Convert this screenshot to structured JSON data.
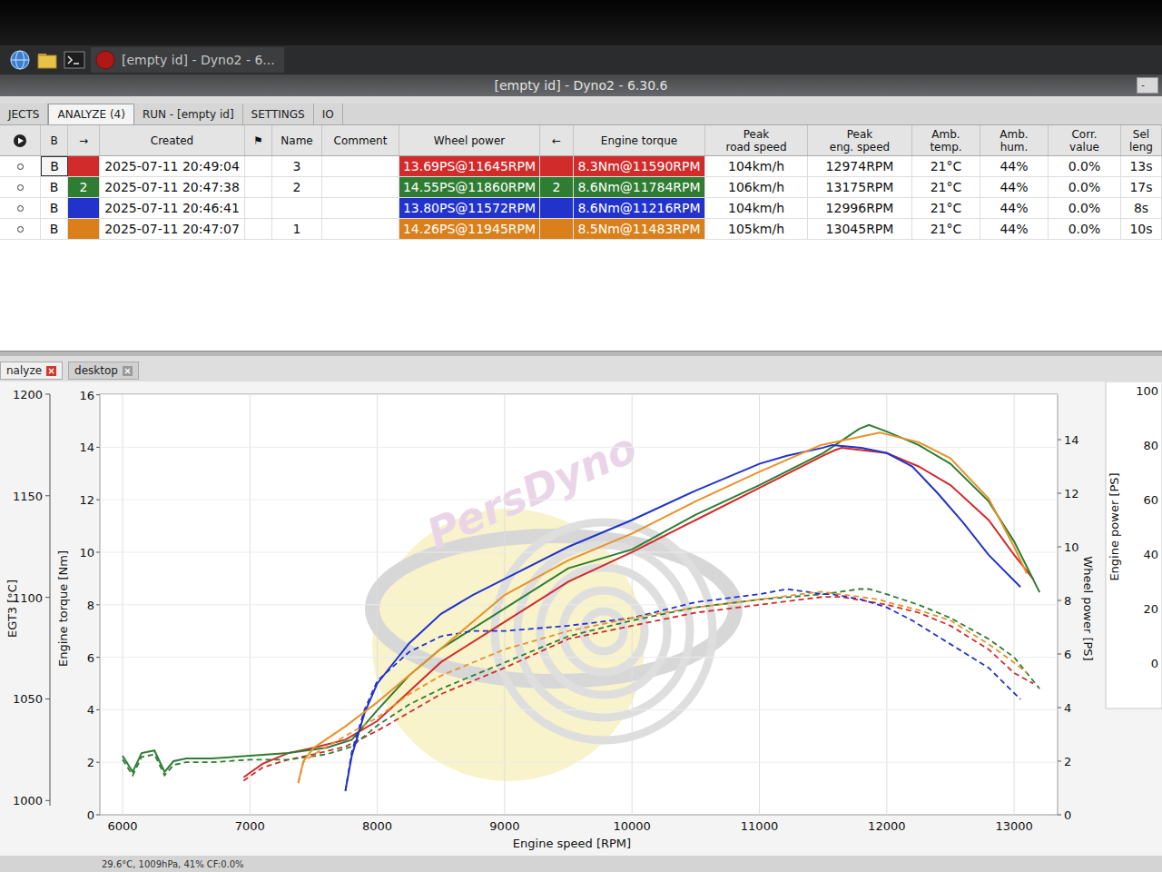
{
  "taskbar": {
    "task": "[empty id] - Dyno2 - 6..."
  },
  "window": {
    "title": "[empty id] - Dyno2 - 6.30.6",
    "button": "-"
  },
  "tabs": [
    {
      "label": "JECTS",
      "selected": false
    },
    {
      "label": "ANALYZE (4)",
      "selected": true
    },
    {
      "label": "RUN - [empty id]",
      "selected": false
    },
    {
      "label": "SETTINGS",
      "selected": false
    },
    {
      "label": "IO",
      "selected": false
    }
  ],
  "table": {
    "columns": [
      [
        "B"
      ],
      [
        "→"
      ],
      [
        "Created"
      ],
      [
        "⚑"
      ],
      [
        "Name"
      ],
      [
        "Comment"
      ],
      [
        "Wheel power"
      ],
      [
        "←"
      ],
      [
        "Engine torque"
      ],
      [
        "Peak",
        "road speed"
      ],
      [
        "Peak",
        "eng. speed"
      ],
      [
        "Amb.",
        "temp."
      ],
      [
        "Amb.",
        "hum."
      ],
      [
        "Corr.",
        "value"
      ],
      [
        "Sel",
        "leng"
      ]
    ],
    "rows": [
      {
        "selected": true,
        "color": "#d22b2b",
        "cells": [
          "B",
          "",
          "2025-07-11 20:49:04",
          "",
          "3",
          "",
          "13.69PS@11645RPM",
          "",
          "8.3Nm@11590RPM",
          "104km/h",
          "12974RPM",
          "21°C",
          "44%",
          "0.0%",
          "13s"
        ]
      },
      {
        "selected": false,
        "color": "#2e7d32",
        "cells": [
          "B",
          "2",
          "2025-07-11 20:47:38",
          "",
          "2",
          "",
          "14.55PS@11860RPM",
          "2",
          "8.6Nm@11784RPM",
          "106km/h",
          "13175RPM",
          "21°C",
          "44%",
          "0.0%",
          "17s"
        ]
      },
      {
        "selected": false,
        "color": "#2233cc",
        "cells": [
          "B",
          "",
          "2025-07-11 20:46:41",
          "",
          "",
          "",
          "13.80PS@11572RPM",
          "",
          "8.6Nm@11216RPM",
          "104km/h",
          "12996RPM",
          "21°C",
          "44%",
          "0.0%",
          "8s"
        ]
      },
      {
        "selected": false,
        "color": "#d9801a",
        "cells": [
          "B",
          "",
          "2025-07-11 20:47:07",
          "",
          "1",
          "",
          "14.26PS@11945RPM",
          "",
          "8.5Nm@11483RPM",
          "105km/h",
          "13045RPM",
          "21°C",
          "44%",
          "0.0%",
          "10s"
        ]
      }
    ]
  },
  "panel_tabs": [
    {
      "label": "nalyze",
      "selected": true
    },
    {
      "label": "desktop",
      "selected": false
    }
  ],
  "chart": {
    "watermark": "PersDyno",
    "x_axis": {
      "label": "Engine speed [RPM]",
      "ticks": [
        "6000",
        "7000",
        "8000",
        "9000",
        "10000",
        "11000",
        "12000",
        "13000"
      ]
    },
    "egt_axis": {
      "label": "EGT3 [°C]",
      "ticks": [
        "1000",
        "1050",
        "1100",
        "1150",
        "1200"
      ]
    },
    "torque_axis": {
      "label": "Engine torque [Nm]",
      "ticks": [
        "0",
        "2",
        "4",
        "6",
        "8",
        "10",
        "12",
        "14",
        "16"
      ]
    },
    "power_axis": {
      "label": "Wheel power [PS]",
      "ticks": [
        "0",
        "2",
        "4",
        "6",
        "8",
        "10",
        "12",
        "14"
      ]
    },
    "engine_power_axis": {
      "label": "Engine power [PS]",
      "ticks": [
        "0",
        "20",
        "40",
        "60",
        "80",
        "100"
      ]
    },
    "series": [
      {
        "color": "#d22b2b",
        "rpm": [
          6950,
          7100,
          7300,
          7500,
          7750,
          8000,
          8250,
          8500,
          9000,
          9500,
          10000,
          10500,
          11000,
          11500,
          11590,
          11645,
          12000,
          12250,
          12500,
          12800,
          13000,
          13150
        ],
        "power": [
          1.4,
          1.9,
          2.3,
          2.5,
          2.8,
          3.5,
          4.6,
          5.7,
          7.2,
          8.7,
          9.8,
          11.0,
          12.2,
          13.4,
          13.6,
          13.69,
          13.5,
          13.0,
          12.3,
          11.0,
          9.7,
          8.8
        ],
        "torque": [
          1.3,
          1.8,
          2.1,
          2.3,
          2.6,
          3.2,
          3.9,
          4.6,
          5.6,
          6.7,
          7.2,
          7.7,
          8.0,
          8.3,
          8.3,
          8.3,
          8.0,
          7.7,
          7.2,
          6.3,
          5.4,
          5.0
        ]
      },
      {
        "color": "#2e7d32",
        "rpm": [
          6000,
          6080,
          6150,
          6250,
          6330,
          6400,
          6500,
          6700,
          7000,
          7300,
          7600,
          7800,
          8000,
          8250,
          8500,
          9000,
          9500,
          10000,
          10500,
          11000,
          11500,
          11784,
          11860,
          12000,
          12250,
          12500,
          12800,
          13000,
          13200
        ],
        "power": [
          2.2,
          1.6,
          2.3,
          2.4,
          1.6,
          2.0,
          2.1,
          2.1,
          2.2,
          2.3,
          2.5,
          2.8,
          3.9,
          5.2,
          6.2,
          7.7,
          9.2,
          9.9,
          11.2,
          12.3,
          13.5,
          14.4,
          14.55,
          14.3,
          13.8,
          13.1,
          11.7,
          10.2,
          8.3
        ],
        "torque": [
          2.1,
          1.5,
          2.2,
          2.3,
          1.5,
          1.9,
          2.0,
          2.0,
          2.1,
          2.1,
          2.3,
          2.6,
          3.4,
          4.2,
          4.8,
          5.8,
          6.8,
          7.4,
          7.9,
          8.2,
          8.4,
          8.6,
          8.6,
          8.4,
          8.0,
          7.5,
          6.7,
          6.0,
          4.8
        ]
      },
      {
        "color": "#2233cc",
        "rpm": [
          7750,
          7800,
          7900,
          8000,
          8250,
          8500,
          8750,
          9000,
          9500,
          10000,
          10500,
          11000,
          11216,
          11500,
          11572,
          11800,
          12000,
          12200,
          12400,
          12600,
          12800,
          13050
        ],
        "power": [
          0.9,
          2.2,
          3.8,
          4.9,
          6.4,
          7.5,
          8.2,
          8.8,
          10.0,
          11.0,
          12.1,
          13.1,
          13.4,
          13.7,
          13.8,
          13.7,
          13.5,
          13.0,
          12.0,
          10.9,
          9.7,
          8.5
        ],
        "torque": [
          0.9,
          2.4,
          4.0,
          5.1,
          6.2,
          6.8,
          7.0,
          7.0,
          7.2,
          7.5,
          8.1,
          8.4,
          8.6,
          8.4,
          8.4,
          8.2,
          7.9,
          7.4,
          6.8,
          6.2,
          5.6,
          4.4
        ]
      },
      {
        "color": "#e8922a",
        "rpm": [
          7380,
          7420,
          7500,
          7750,
          8000,
          8250,
          8500,
          9000,
          9500,
          10000,
          10500,
          11000,
          11483,
          11945,
          12000,
          12250,
          12500,
          12800,
          13000,
          13100
        ],
        "power": [
          1.2,
          2.0,
          2.5,
          3.3,
          4.2,
          5.2,
          6.2,
          8.2,
          9.5,
          10.5,
          11.7,
          12.8,
          13.8,
          14.26,
          14.2,
          13.9,
          13.3,
          11.8,
          10.0,
          9.0
        ],
        "torque": [
          1.2,
          2.0,
          2.3,
          3.0,
          3.7,
          4.6,
          5.3,
          6.3,
          7.0,
          7.5,
          7.9,
          8.2,
          8.5,
          8.2,
          8.1,
          7.8,
          7.4,
          6.5,
          5.8,
          5.4
        ]
      }
    ]
  },
  "status_bar": {
    "text": "29.6°C, 1009hPa, 41% CF:0.0%"
  }
}
